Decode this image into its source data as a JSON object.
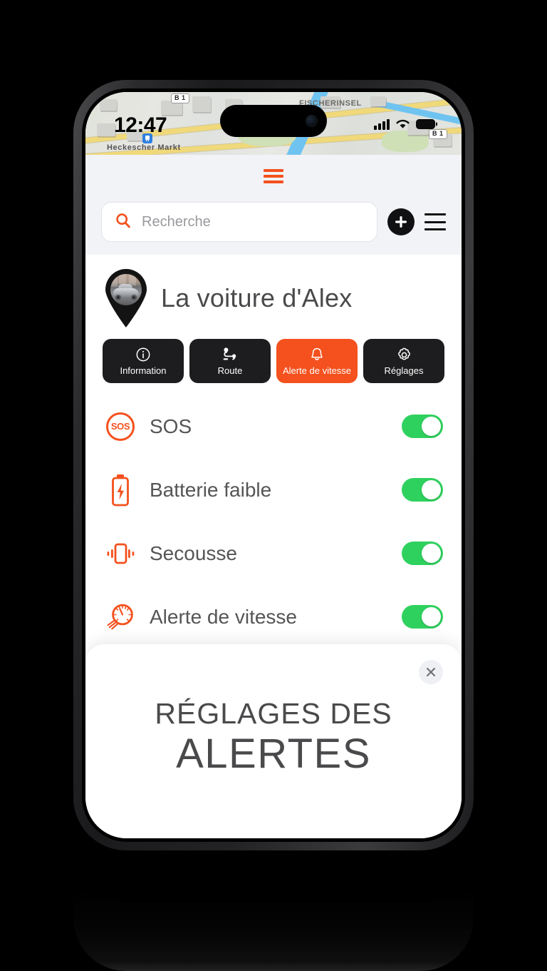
{
  "status_bar": {
    "time": "12:47",
    "cellular_icon": "signal-bars-icon",
    "wifi_icon": "wifi-icon",
    "battery_icon": "battery-icon"
  },
  "map_backdrop": {
    "labels": [
      "FISCHERINSEL",
      "Heckescher Markt"
    ],
    "road_shields": [
      "B 1",
      "B 1"
    ],
    "transit_icon": "transit-station-icon"
  },
  "header": {
    "drag_handle_name": "drag-handle",
    "drag_handle_color": "#f4511e"
  },
  "search": {
    "placeholder": "Recherche",
    "value": "",
    "icon": "search-icon",
    "add_button_icon": "plus-icon",
    "menu_button_icon": "hamburger-menu-icon"
  },
  "vehicle": {
    "name": "La voiture d'Alex",
    "avatar_icon": "map-pin-avatar",
    "avatar_photo": "car-photo"
  },
  "actions": [
    {
      "label": "Information",
      "icon": "info-circle-icon",
      "active": false
    },
    {
      "label": "Route",
      "icon": "route-icon",
      "active": false
    },
    {
      "label": "Alerte de vitesse",
      "icon": "bell-icon",
      "active": true
    },
    {
      "label": "Réglages",
      "icon": "gear-icon",
      "active": false
    }
  ],
  "alerts": [
    {
      "label": "SOS",
      "icon": "sos-icon",
      "enabled": true,
      "state": "on"
    },
    {
      "label": "Batterie faible",
      "icon": "low-battery-icon",
      "enabled": true,
      "state": "on"
    },
    {
      "label": "Secousse",
      "icon": "vibration-icon",
      "enabled": true,
      "state": "on"
    },
    {
      "label": "Alerte de vitesse",
      "icon": "speedometer-icon",
      "enabled": true,
      "state": "on"
    }
  ],
  "sheet": {
    "title_line1": "RÉGLAGES DES",
    "title_line2": "ALERTES",
    "close_icon": "close-icon"
  },
  "colors": {
    "accent_orange": "#f4511e",
    "toggle_green": "#2fd15e",
    "dark_button": "#1d1d1f",
    "text_gray": "#4a4a4c",
    "page_background": "#f2f3f7"
  }
}
